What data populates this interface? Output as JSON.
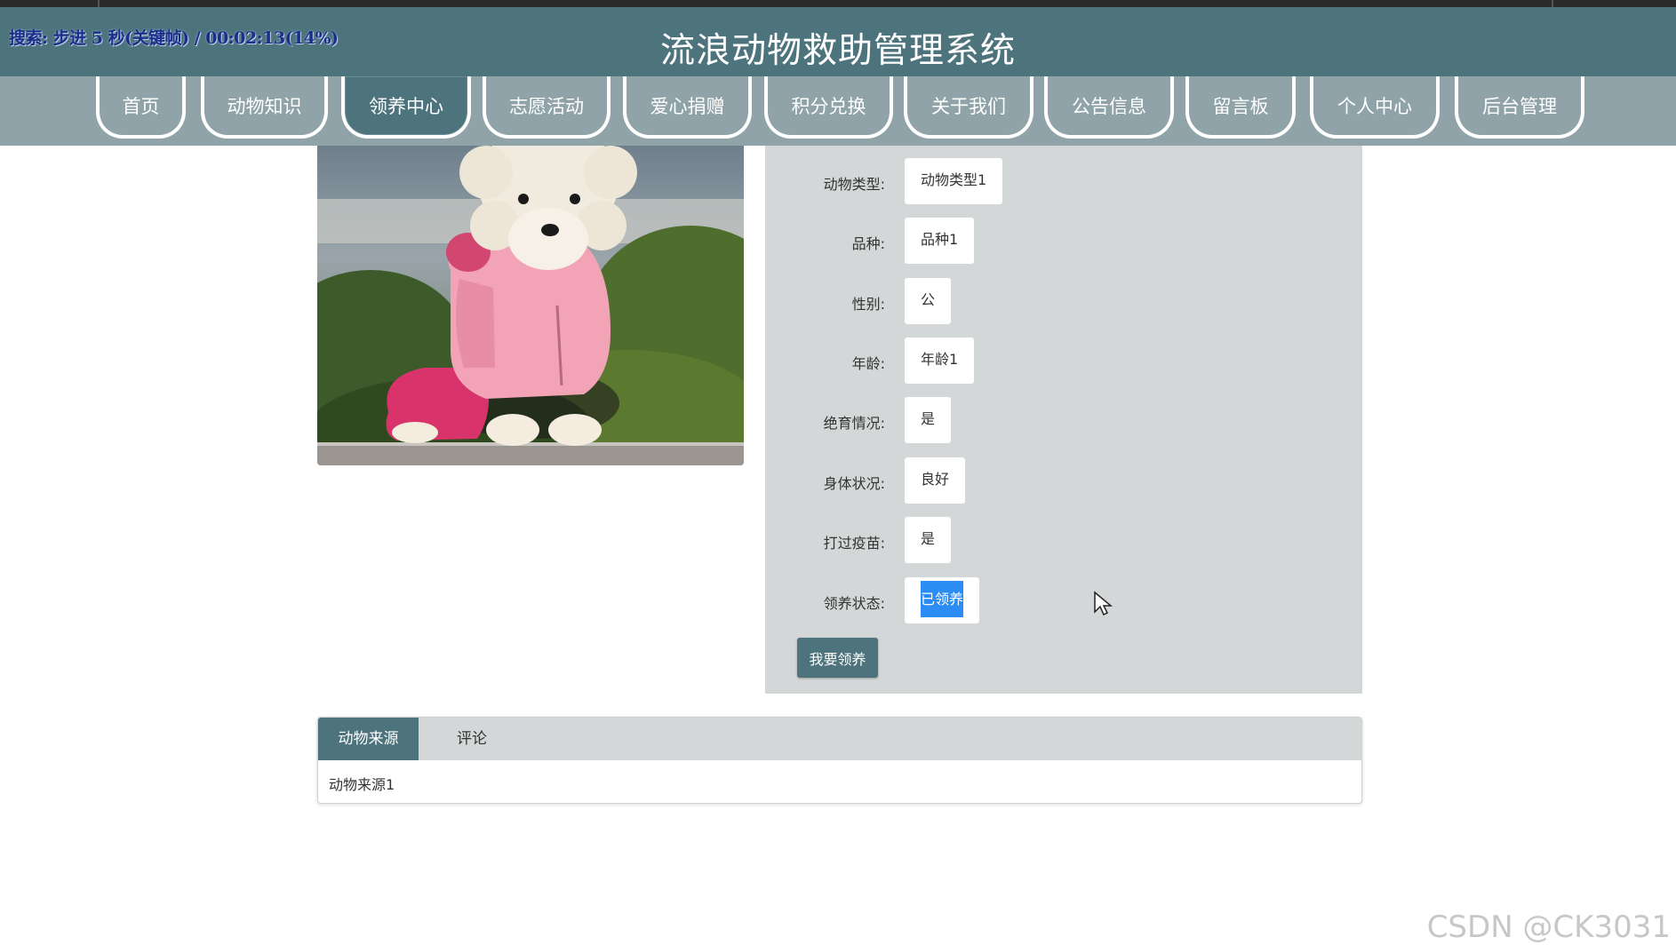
{
  "overlay": {
    "text": "搜索: 步进 5 秒(关键帧) / 00:02:13(14%)"
  },
  "site": {
    "title": "流浪动物救助管理系统"
  },
  "nav": {
    "items": [
      {
        "label": "首页"
      },
      {
        "label": "动物知识"
      },
      {
        "label": "领养中心",
        "active": true
      },
      {
        "label": "志愿活动"
      },
      {
        "label": "爱心捐赠"
      },
      {
        "label": "积分兑换"
      },
      {
        "label": "关于我们"
      },
      {
        "label": "公告信息"
      },
      {
        "label": "留言板"
      },
      {
        "label": "个人中心"
      },
      {
        "label": "后台管理"
      }
    ]
  },
  "detail": {
    "image_alt": "white poodle in pink coat",
    "fields": [
      {
        "label": "动物类型:",
        "value": "动物类型1"
      },
      {
        "label": "品种:",
        "value": "品种1"
      },
      {
        "label": "性别:",
        "value": "公"
      },
      {
        "label": "年龄:",
        "value": "年龄1"
      },
      {
        "label": "绝育情况:",
        "value": "是"
      },
      {
        "label": "身体状况:",
        "value": "良好"
      },
      {
        "label": "打过疫苗:",
        "value": "是"
      },
      {
        "label": "领养状态:",
        "value": "已领养"
      }
    ],
    "adopt_button": "我要领养"
  },
  "tabs": {
    "items": [
      {
        "label": "动物来源",
        "active": true
      },
      {
        "label": "评论"
      }
    ],
    "content": "动物来源1"
  },
  "watermark": "CSDN @CK3031",
  "colors": {
    "primary": "#4d737c",
    "nav_bg": "#8fa3a8",
    "panel_bg": "#d3d7d7",
    "selection": "#2b8cf3"
  }
}
